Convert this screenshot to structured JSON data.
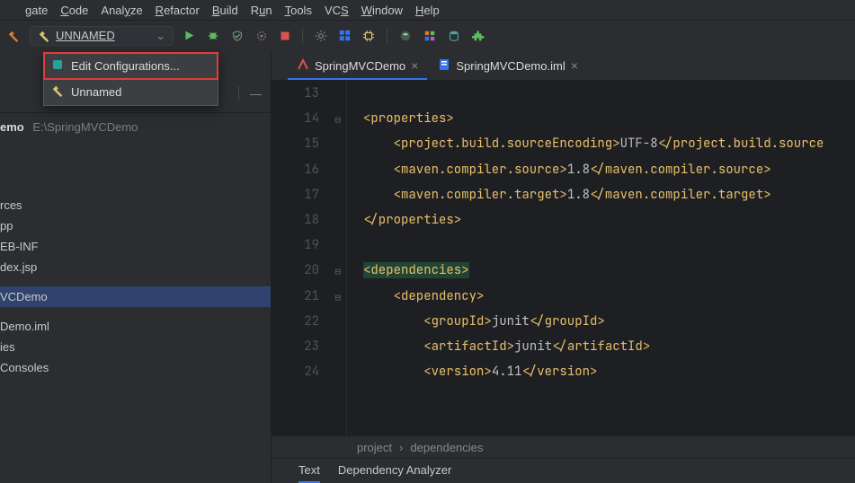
{
  "menu": {
    "items": [
      "gate",
      "Code",
      "Analyze",
      "Refactor",
      "Build",
      "Run",
      "Tools",
      "VCS",
      "Window",
      "Help"
    ],
    "underline_idx": [
      null,
      0,
      4,
      0,
      0,
      1,
      0,
      2,
      0,
      0
    ]
  },
  "run_config": {
    "label": "UNNAMED"
  },
  "dropdown": {
    "items": [
      {
        "label": "Edit Configurations...",
        "icon": "config-icon",
        "highlighted": true
      },
      {
        "label": "Unnamed",
        "icon": "hammer-icon",
        "highlighted": false
      }
    ]
  },
  "project_header": {
    "name": "emo",
    "path": "E:\\SpringMVCDemo"
  },
  "tree": [
    {
      "label": "rces"
    },
    {
      "label": "pp"
    },
    {
      "label": "EB-INF"
    },
    {
      "label": "dex.jsp"
    },
    {
      "label": "VCDemo",
      "selected": true
    },
    {
      "label": "Demo.iml"
    },
    {
      "label": "ies"
    },
    {
      "label": "Consoles"
    }
  ],
  "tabs": [
    {
      "label": "SpringMVCDemo",
      "icon": "maven-icon",
      "active": true
    },
    {
      "label": "SpringMVCDemo.iml",
      "icon": "iml-icon",
      "active": false
    }
  ],
  "code": {
    "lines": [
      {
        "n": 13,
        "html": ""
      },
      {
        "n": 14,
        "fold": true,
        "html": "<span class='t-tag'>&lt;properties&gt;</span>"
      },
      {
        "n": 15,
        "html": "    <span class='t-tag'>&lt;project.build.sourceEncoding&gt;</span><span class='t-text'>UTF-8</span><span class='t-tag'>&lt;/project.build.source</span>"
      },
      {
        "n": 16,
        "html": "    <span class='t-tag'>&lt;maven.compiler.source&gt;</span><span class='t-text'>1.8</span><span class='t-tag'>&lt;/maven.compiler.source&gt;</span>"
      },
      {
        "n": 17,
        "html": "    <span class='t-tag'>&lt;maven.compiler.target&gt;</span><span class='t-text'>1.8</span><span class='t-tag'>&lt;/maven.compiler.target&gt;</span>"
      },
      {
        "n": 18,
        "html": "<span class='t-tag'>&lt;/properties&gt;</span>"
      },
      {
        "n": 19,
        "html": ""
      },
      {
        "n": 20,
        "fold": true,
        "html": "<span class='t-tag t-hl'>&lt;dependencies&gt;</span>"
      },
      {
        "n": 21,
        "fold": true,
        "html": "    <span class='t-tag'>&lt;dependency&gt;</span>"
      },
      {
        "n": 22,
        "html": "        <span class='t-tag'>&lt;groupId&gt;</span><span class='t-text'>junit</span><span class='t-tag'>&lt;/groupId&gt;</span>"
      },
      {
        "n": 23,
        "html": "        <span class='t-tag'>&lt;artifactId&gt;</span><span class='t-text'>junit</span><span class='t-tag'>&lt;/artifactId&gt;</span>"
      },
      {
        "n": 24,
        "html": "        <span class='t-tag'>&lt;version&gt;</span><span class='t-text'>4.11</span><span class='t-tag'>&lt;/version&gt;</span>"
      }
    ]
  },
  "breadcrumb": {
    "items": [
      "project",
      "dependencies"
    ]
  },
  "bottom_tabs": [
    {
      "label": "Text",
      "active": true
    },
    {
      "label": "Dependency Analyzer",
      "active": false
    }
  ],
  "toolbar_icons": [
    "play",
    "bug",
    "coverage",
    "profile",
    "stop",
    "spacer",
    "gear",
    "grid",
    "cpu",
    "spacer",
    "db-round",
    "palette",
    "db-tool",
    "puzzle"
  ],
  "colors": {
    "bg": "#2b2d30",
    "editor_bg": "#1e1f22",
    "tag": "#e8bf6a",
    "text": "#c0c0c0",
    "highlight_border": "#e23b3b",
    "tab_active": "#3574f0",
    "play": "#5dbb63",
    "stop": "#d9534f"
  }
}
